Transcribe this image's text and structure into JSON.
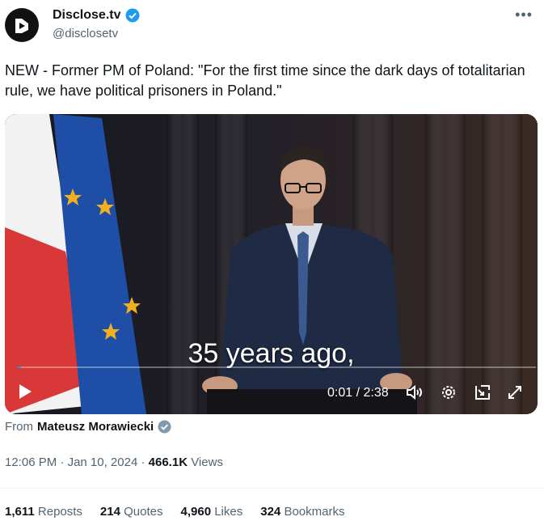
{
  "account": {
    "name": "Disclose.tv",
    "handle": "@disclosetv",
    "verified_color": "#1d9bf0"
  },
  "post": {
    "text": "NEW - Former PM of Poland: \"For the first time since the dark days of totalitarian rule, we have political prisoners in Poland.\""
  },
  "video": {
    "caption": "35 years ago,",
    "current_time": "0:01",
    "duration": "2:38",
    "time_display": "0:01 / 2:38",
    "progress": 0.006
  },
  "attribution": {
    "prefix": "From",
    "name": "Mateusz Morawiecki"
  },
  "meta": {
    "time": "12:06 PM",
    "date": "Jan 10, 2024",
    "views_count": "466.1K",
    "views_label": "Views"
  },
  "stats": {
    "reposts_count": "1,611",
    "reposts_label": "Reposts",
    "quotes_count": "214",
    "quotes_label": "Quotes",
    "likes_count": "4,960",
    "likes_label": "Likes",
    "bookmarks_count": "324",
    "bookmarks_label": "Bookmarks"
  }
}
